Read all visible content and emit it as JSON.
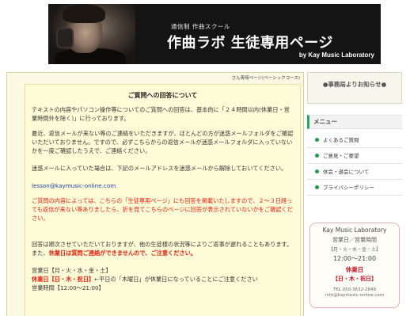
{
  "banner": {
    "subtitle": "通信制 作曲スクール",
    "title": "作曲ラボ 生徒専用ページ",
    "brand": "by Kay Music Laboratory"
  },
  "main": {
    "page_label": "さん専用ページ(ベーシックコース)",
    "heading": "ご質問への回答について",
    "para1": "テキストの内容やパソコン操作等についてのご質問への回答は、基本的に「２４時間以内(休業日・営業時間外を除く)」に行っております。",
    "para2": "最近、返信メールが来ない等のご連絡をいただきますが、ほとんどの方が迷惑メールフォルダをご確認いただいておりません。ですので、必ずこちらからの返信メールが迷惑メールフォルダに入っていないかを一度ご確認したうえで、ご連絡ください。",
    "para3": "迷惑メールに入っていた場合は、下記のメールアドレスを迷惑メールから解除しておいてください。",
    "email": "lesson@kaymusic-online.com",
    "para4": "ご質問の内容によっては、こちらの「生徒専用ページ」にも回答を掲載いたしますので、２～３日経っても返信が来ない等ありましたら、折を見てこちらのページに回答が表示されていないかをご確認ください。",
    "para5_a": "回答は順次させていただいておりますが、他の生徒様の状況等によりご返事が遅れることもあります。また、",
    "para5_b": "休業日は質問ご連絡ができませんので、ご注意ください。",
    "hours1": "営業日【月・火・水・金・土】",
    "hours2_red": "休業日【日・木・祝日】",
    "hours2_rest": "←平日の「木曜日」が休業日になっていることにご注意ください",
    "hours3": "営業時間【12:00～21:00】"
  },
  "sidebar": {
    "notice": "●事務局よりお知らせ●",
    "menu_title": "メニュー",
    "items": [
      "よくあるご質問",
      "ご意見・ご要望",
      "休会・退会について",
      "プライバシーポリシー"
    ],
    "info": {
      "name": "Kay Music Laboratory",
      "label": "営業日／営業時間",
      "days": "【月・火・水・金・土】",
      "time": "12:00～21:00",
      "closed_label": "休業日",
      "closed_days": "【日・木・祝日】",
      "tel": "TEL 050-3632-2849",
      "email": "info@kaymusic-online.com"
    }
  }
}
